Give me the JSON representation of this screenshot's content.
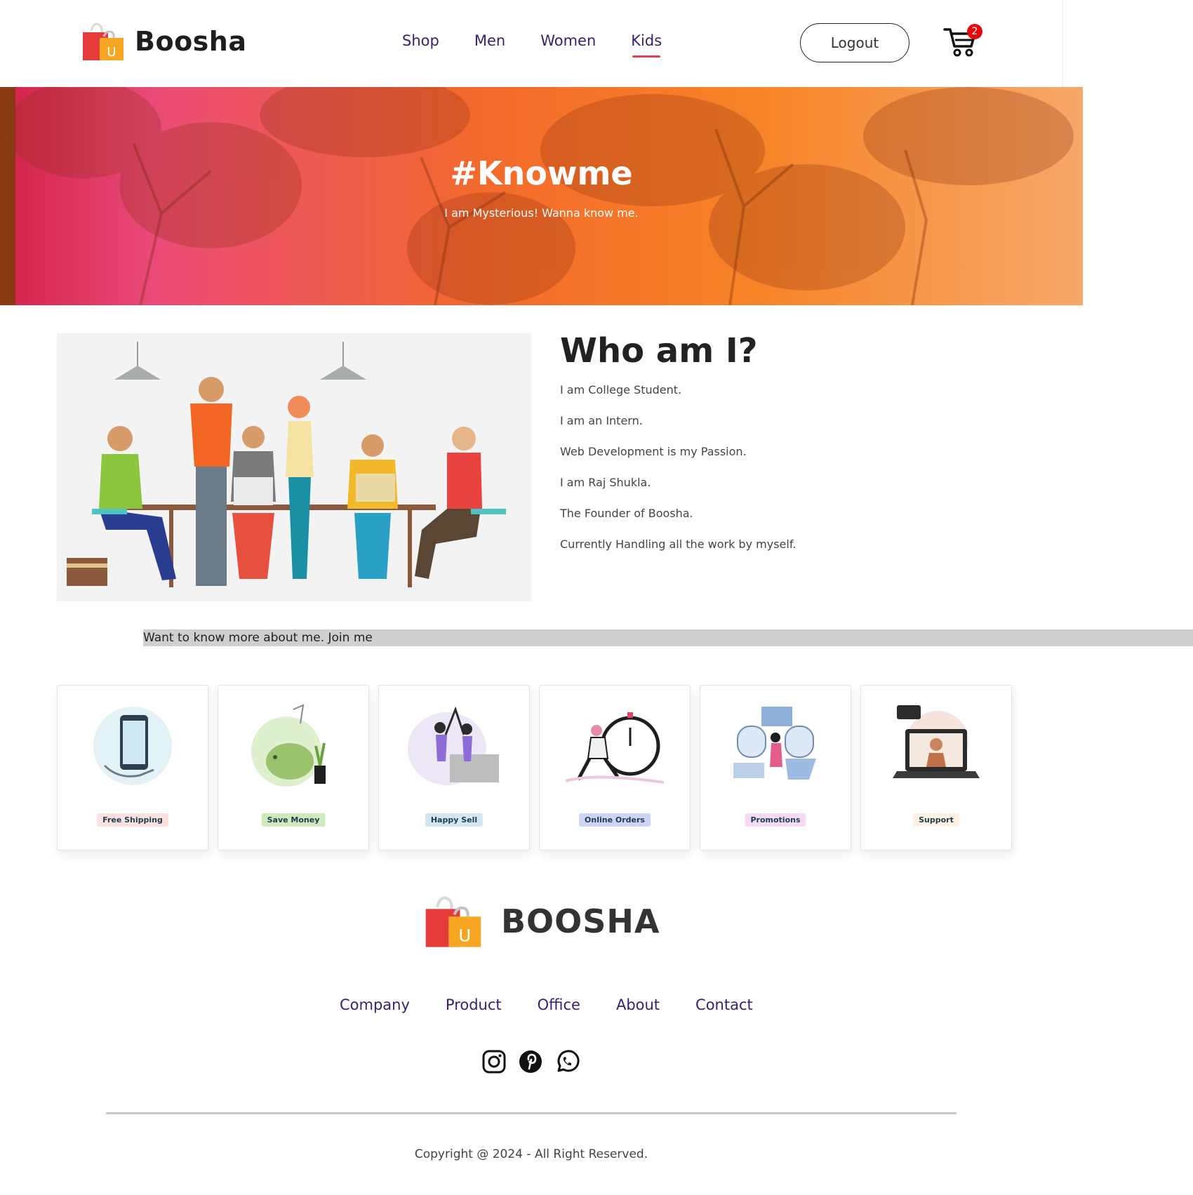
{
  "header": {
    "brand": "Boosha",
    "nav": [
      {
        "label": "Shop",
        "active": false
      },
      {
        "label": "Men",
        "active": false
      },
      {
        "label": "Women",
        "active": false
      },
      {
        "label": "Kids",
        "active": true
      }
    ],
    "logout_label": "Logout",
    "cart_icon": "cart-icon",
    "cart_count": "2"
  },
  "hero": {
    "title": "#Knowme",
    "subtitle": "I am Mysterious! Wanna know me."
  },
  "about": {
    "title": "Who am I?",
    "lines": [
      "I am College Student.",
      "I am an Intern.",
      "Web Development is my Passion.",
      "I am Raj Shukla.",
      "The Founder of Boosha.",
      "Currently Handling all the work by myself."
    ]
  },
  "join": {
    "text": "Want to know more about me. Join me"
  },
  "features": [
    {
      "label": "Free Shipping",
      "color": "#fde1e1"
    },
    {
      "label": "Save Money",
      "color": "#cdebbc"
    },
    {
      "label": "Happy Sell",
      "color": "#d1e8f2"
    },
    {
      "label": "Online Orders",
      "color": "#cdd4f8"
    },
    {
      "label": "Promotions",
      "color": "#f6dbf6"
    },
    {
      "label": "Support",
      "color": "#fff2e5"
    }
  ],
  "footer": {
    "brand": "BOOSHA",
    "links": [
      "Company",
      "Product",
      "Office",
      "About",
      "Contact"
    ],
    "socials": [
      "instagram-icon",
      "pinterest-icon",
      "whatsapp-icon"
    ],
    "copyright": "Copyright @ 2024 - All Right Reserved."
  },
  "colors": {
    "nav_text": "#3b1e6e",
    "active_underline": "#e0414e",
    "badge": "#e30b0b"
  }
}
